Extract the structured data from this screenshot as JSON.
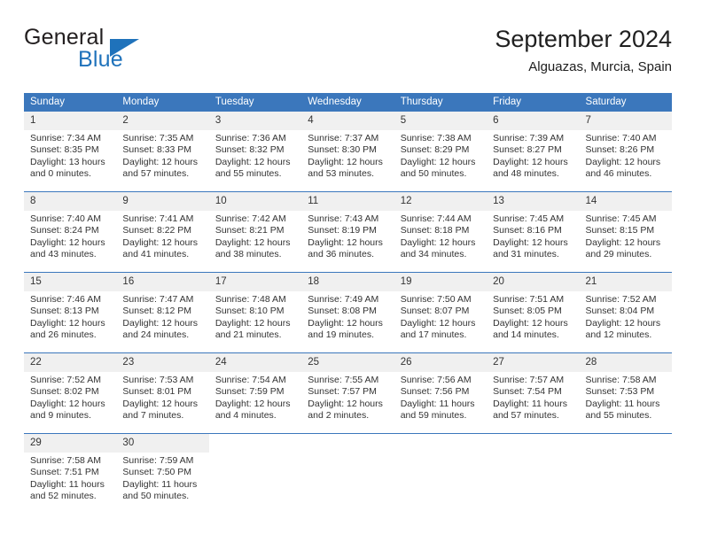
{
  "brand": {
    "word_general": "General",
    "word_blue": "Blue",
    "triangle_icon": "triangle-icon",
    "accent_color": "#1f72bb"
  },
  "header": {
    "title": "September 2024",
    "subtitle": "Alguazas, Murcia, Spain"
  },
  "theme": {
    "header_blue": "#3b77bc",
    "daynum_band": "#f0f0f0",
    "text": "#333333"
  },
  "weekday_headers": [
    "Sunday",
    "Monday",
    "Tuesday",
    "Wednesday",
    "Thursday",
    "Friday",
    "Saturday"
  ],
  "labels": {
    "sunrise_prefix": "Sunrise:",
    "sunset_prefix": "Sunset:",
    "daylight_prefix": "Daylight:"
  },
  "weeks": [
    [
      {
        "day": "1",
        "sunrise": "Sunrise: 7:34 AM",
        "sunset": "Sunset: 8:35 PM",
        "daylight_line1": "Daylight: 13 hours",
        "daylight_line2": "and 0 minutes."
      },
      {
        "day": "2",
        "sunrise": "Sunrise: 7:35 AM",
        "sunset": "Sunset: 8:33 PM",
        "daylight_line1": "Daylight: 12 hours",
        "daylight_line2": "and 57 minutes."
      },
      {
        "day": "3",
        "sunrise": "Sunrise: 7:36 AM",
        "sunset": "Sunset: 8:32 PM",
        "daylight_line1": "Daylight: 12 hours",
        "daylight_line2": "and 55 minutes."
      },
      {
        "day": "4",
        "sunrise": "Sunrise: 7:37 AM",
        "sunset": "Sunset: 8:30 PM",
        "daylight_line1": "Daylight: 12 hours",
        "daylight_line2": "and 53 minutes."
      },
      {
        "day": "5",
        "sunrise": "Sunrise: 7:38 AM",
        "sunset": "Sunset: 8:29 PM",
        "daylight_line1": "Daylight: 12 hours",
        "daylight_line2": "and 50 minutes."
      },
      {
        "day": "6",
        "sunrise": "Sunrise: 7:39 AM",
        "sunset": "Sunset: 8:27 PM",
        "daylight_line1": "Daylight: 12 hours",
        "daylight_line2": "and 48 minutes."
      },
      {
        "day": "7",
        "sunrise": "Sunrise: 7:40 AM",
        "sunset": "Sunset: 8:26 PM",
        "daylight_line1": "Daylight: 12 hours",
        "daylight_line2": "and 46 minutes."
      }
    ],
    [
      {
        "day": "8",
        "sunrise": "Sunrise: 7:40 AM",
        "sunset": "Sunset: 8:24 PM",
        "daylight_line1": "Daylight: 12 hours",
        "daylight_line2": "and 43 minutes."
      },
      {
        "day": "9",
        "sunrise": "Sunrise: 7:41 AM",
        "sunset": "Sunset: 8:22 PM",
        "daylight_line1": "Daylight: 12 hours",
        "daylight_line2": "and 41 minutes."
      },
      {
        "day": "10",
        "sunrise": "Sunrise: 7:42 AM",
        "sunset": "Sunset: 8:21 PM",
        "daylight_line1": "Daylight: 12 hours",
        "daylight_line2": "and 38 minutes."
      },
      {
        "day": "11",
        "sunrise": "Sunrise: 7:43 AM",
        "sunset": "Sunset: 8:19 PM",
        "daylight_line1": "Daylight: 12 hours",
        "daylight_line2": "and 36 minutes."
      },
      {
        "day": "12",
        "sunrise": "Sunrise: 7:44 AM",
        "sunset": "Sunset: 8:18 PM",
        "daylight_line1": "Daylight: 12 hours",
        "daylight_line2": "and 34 minutes."
      },
      {
        "day": "13",
        "sunrise": "Sunrise: 7:45 AM",
        "sunset": "Sunset: 8:16 PM",
        "daylight_line1": "Daylight: 12 hours",
        "daylight_line2": "and 31 minutes."
      },
      {
        "day": "14",
        "sunrise": "Sunrise: 7:45 AM",
        "sunset": "Sunset: 8:15 PM",
        "daylight_line1": "Daylight: 12 hours",
        "daylight_line2": "and 29 minutes."
      }
    ],
    [
      {
        "day": "15",
        "sunrise": "Sunrise: 7:46 AM",
        "sunset": "Sunset: 8:13 PM",
        "daylight_line1": "Daylight: 12 hours",
        "daylight_line2": "and 26 minutes."
      },
      {
        "day": "16",
        "sunrise": "Sunrise: 7:47 AM",
        "sunset": "Sunset: 8:12 PM",
        "daylight_line1": "Daylight: 12 hours",
        "daylight_line2": "and 24 minutes."
      },
      {
        "day": "17",
        "sunrise": "Sunrise: 7:48 AM",
        "sunset": "Sunset: 8:10 PM",
        "daylight_line1": "Daylight: 12 hours",
        "daylight_line2": "and 21 minutes."
      },
      {
        "day": "18",
        "sunrise": "Sunrise: 7:49 AM",
        "sunset": "Sunset: 8:08 PM",
        "daylight_line1": "Daylight: 12 hours",
        "daylight_line2": "and 19 minutes."
      },
      {
        "day": "19",
        "sunrise": "Sunrise: 7:50 AM",
        "sunset": "Sunset: 8:07 PM",
        "daylight_line1": "Daylight: 12 hours",
        "daylight_line2": "and 17 minutes."
      },
      {
        "day": "20",
        "sunrise": "Sunrise: 7:51 AM",
        "sunset": "Sunset: 8:05 PM",
        "daylight_line1": "Daylight: 12 hours",
        "daylight_line2": "and 14 minutes."
      },
      {
        "day": "21",
        "sunrise": "Sunrise: 7:52 AM",
        "sunset": "Sunset: 8:04 PM",
        "daylight_line1": "Daylight: 12 hours",
        "daylight_line2": "and 12 minutes."
      }
    ],
    [
      {
        "day": "22",
        "sunrise": "Sunrise: 7:52 AM",
        "sunset": "Sunset: 8:02 PM",
        "daylight_line1": "Daylight: 12 hours",
        "daylight_line2": "and 9 minutes."
      },
      {
        "day": "23",
        "sunrise": "Sunrise: 7:53 AM",
        "sunset": "Sunset: 8:01 PM",
        "daylight_line1": "Daylight: 12 hours",
        "daylight_line2": "and 7 minutes."
      },
      {
        "day": "24",
        "sunrise": "Sunrise: 7:54 AM",
        "sunset": "Sunset: 7:59 PM",
        "daylight_line1": "Daylight: 12 hours",
        "daylight_line2": "and 4 minutes."
      },
      {
        "day": "25",
        "sunrise": "Sunrise: 7:55 AM",
        "sunset": "Sunset: 7:57 PM",
        "daylight_line1": "Daylight: 12 hours",
        "daylight_line2": "and 2 minutes."
      },
      {
        "day": "26",
        "sunrise": "Sunrise: 7:56 AM",
        "sunset": "Sunset: 7:56 PM",
        "daylight_line1": "Daylight: 11 hours",
        "daylight_line2": "and 59 minutes."
      },
      {
        "day": "27",
        "sunrise": "Sunrise: 7:57 AM",
        "sunset": "Sunset: 7:54 PM",
        "daylight_line1": "Daylight: 11 hours",
        "daylight_line2": "and 57 minutes."
      },
      {
        "day": "28",
        "sunrise": "Sunrise: 7:58 AM",
        "sunset": "Sunset: 7:53 PM",
        "daylight_line1": "Daylight: 11 hours",
        "daylight_line2": "and 55 minutes."
      }
    ],
    [
      {
        "day": "29",
        "sunrise": "Sunrise: 7:58 AM",
        "sunset": "Sunset: 7:51 PM",
        "daylight_line1": "Daylight: 11 hours",
        "daylight_line2": "and 52 minutes."
      },
      {
        "day": "30",
        "sunrise": "Sunrise: 7:59 AM",
        "sunset": "Sunset: 7:50 PM",
        "daylight_line1": "Daylight: 11 hours",
        "daylight_line2": "and 50 minutes."
      },
      {
        "day": "",
        "sunrise": "",
        "sunset": "",
        "daylight_line1": "",
        "daylight_line2": ""
      },
      {
        "day": "",
        "sunrise": "",
        "sunset": "",
        "daylight_line1": "",
        "daylight_line2": ""
      },
      {
        "day": "",
        "sunrise": "",
        "sunset": "",
        "daylight_line1": "",
        "daylight_line2": ""
      },
      {
        "day": "",
        "sunrise": "",
        "sunset": "",
        "daylight_line1": "",
        "daylight_line2": ""
      },
      {
        "day": "",
        "sunrise": "",
        "sunset": "",
        "daylight_line1": "",
        "daylight_line2": ""
      }
    ]
  ]
}
